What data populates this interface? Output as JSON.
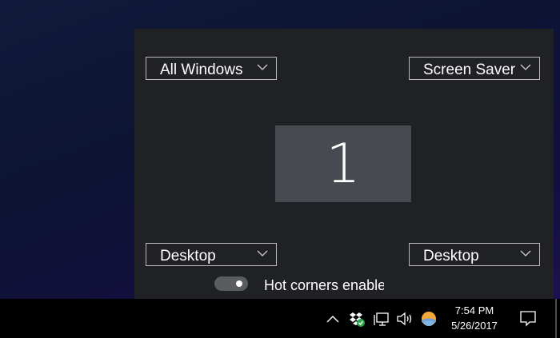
{
  "hot_corners": {
    "top_left": "All Windows",
    "top_right": "Screen Saver",
    "bottom_left": "Desktop",
    "bottom_right": "Desktop",
    "monitor_label": "1",
    "toggle_label": "Hot corners enabled",
    "toggle_on": true
  },
  "taskbar": {
    "time": "7:54 PM",
    "date": "5/26/2017",
    "icons": [
      "chevron-up-icon",
      "dropbox-icon",
      "network-icon",
      "volume-icon",
      "weather-icon",
      "notification-icon"
    ]
  }
}
